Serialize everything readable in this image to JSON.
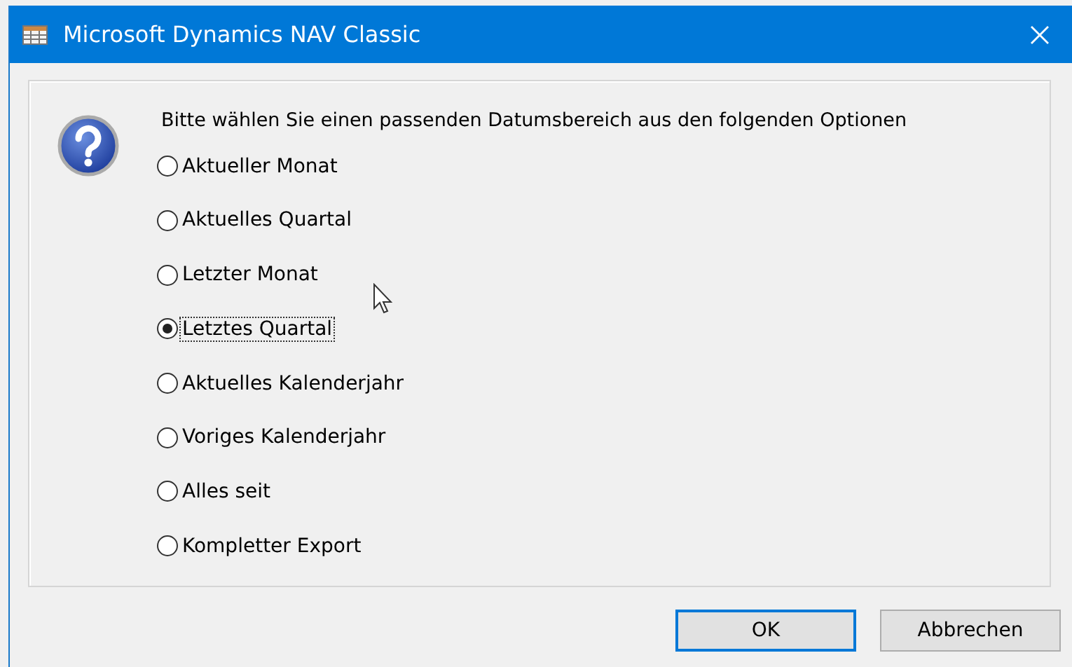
{
  "window": {
    "title": "Microsoft Dynamics NAV Classic"
  },
  "prompt": "Bitte wählen Sie einen passenden Datumsbereich aus den folgenden Optionen",
  "options": [
    {
      "label": "Aktueller Monat",
      "selected": false
    },
    {
      "label": "Aktuelles Quartal",
      "selected": false
    },
    {
      "label": "Letzter Monat",
      "selected": false
    },
    {
      "label": "Letztes Quartal",
      "selected": true
    },
    {
      "label": "Aktuelles Kalenderjahr",
      "selected": false
    },
    {
      "label": "Voriges Kalenderjahr",
      "selected": false
    },
    {
      "label": "Alles seit",
      "selected": false
    },
    {
      "label": "Kompletter Export",
      "selected": false
    }
  ],
  "buttons": [
    {
      "label": "OK",
      "kind": "default"
    },
    {
      "label": "Abbrechen",
      "kind": "normal"
    }
  ]
}
